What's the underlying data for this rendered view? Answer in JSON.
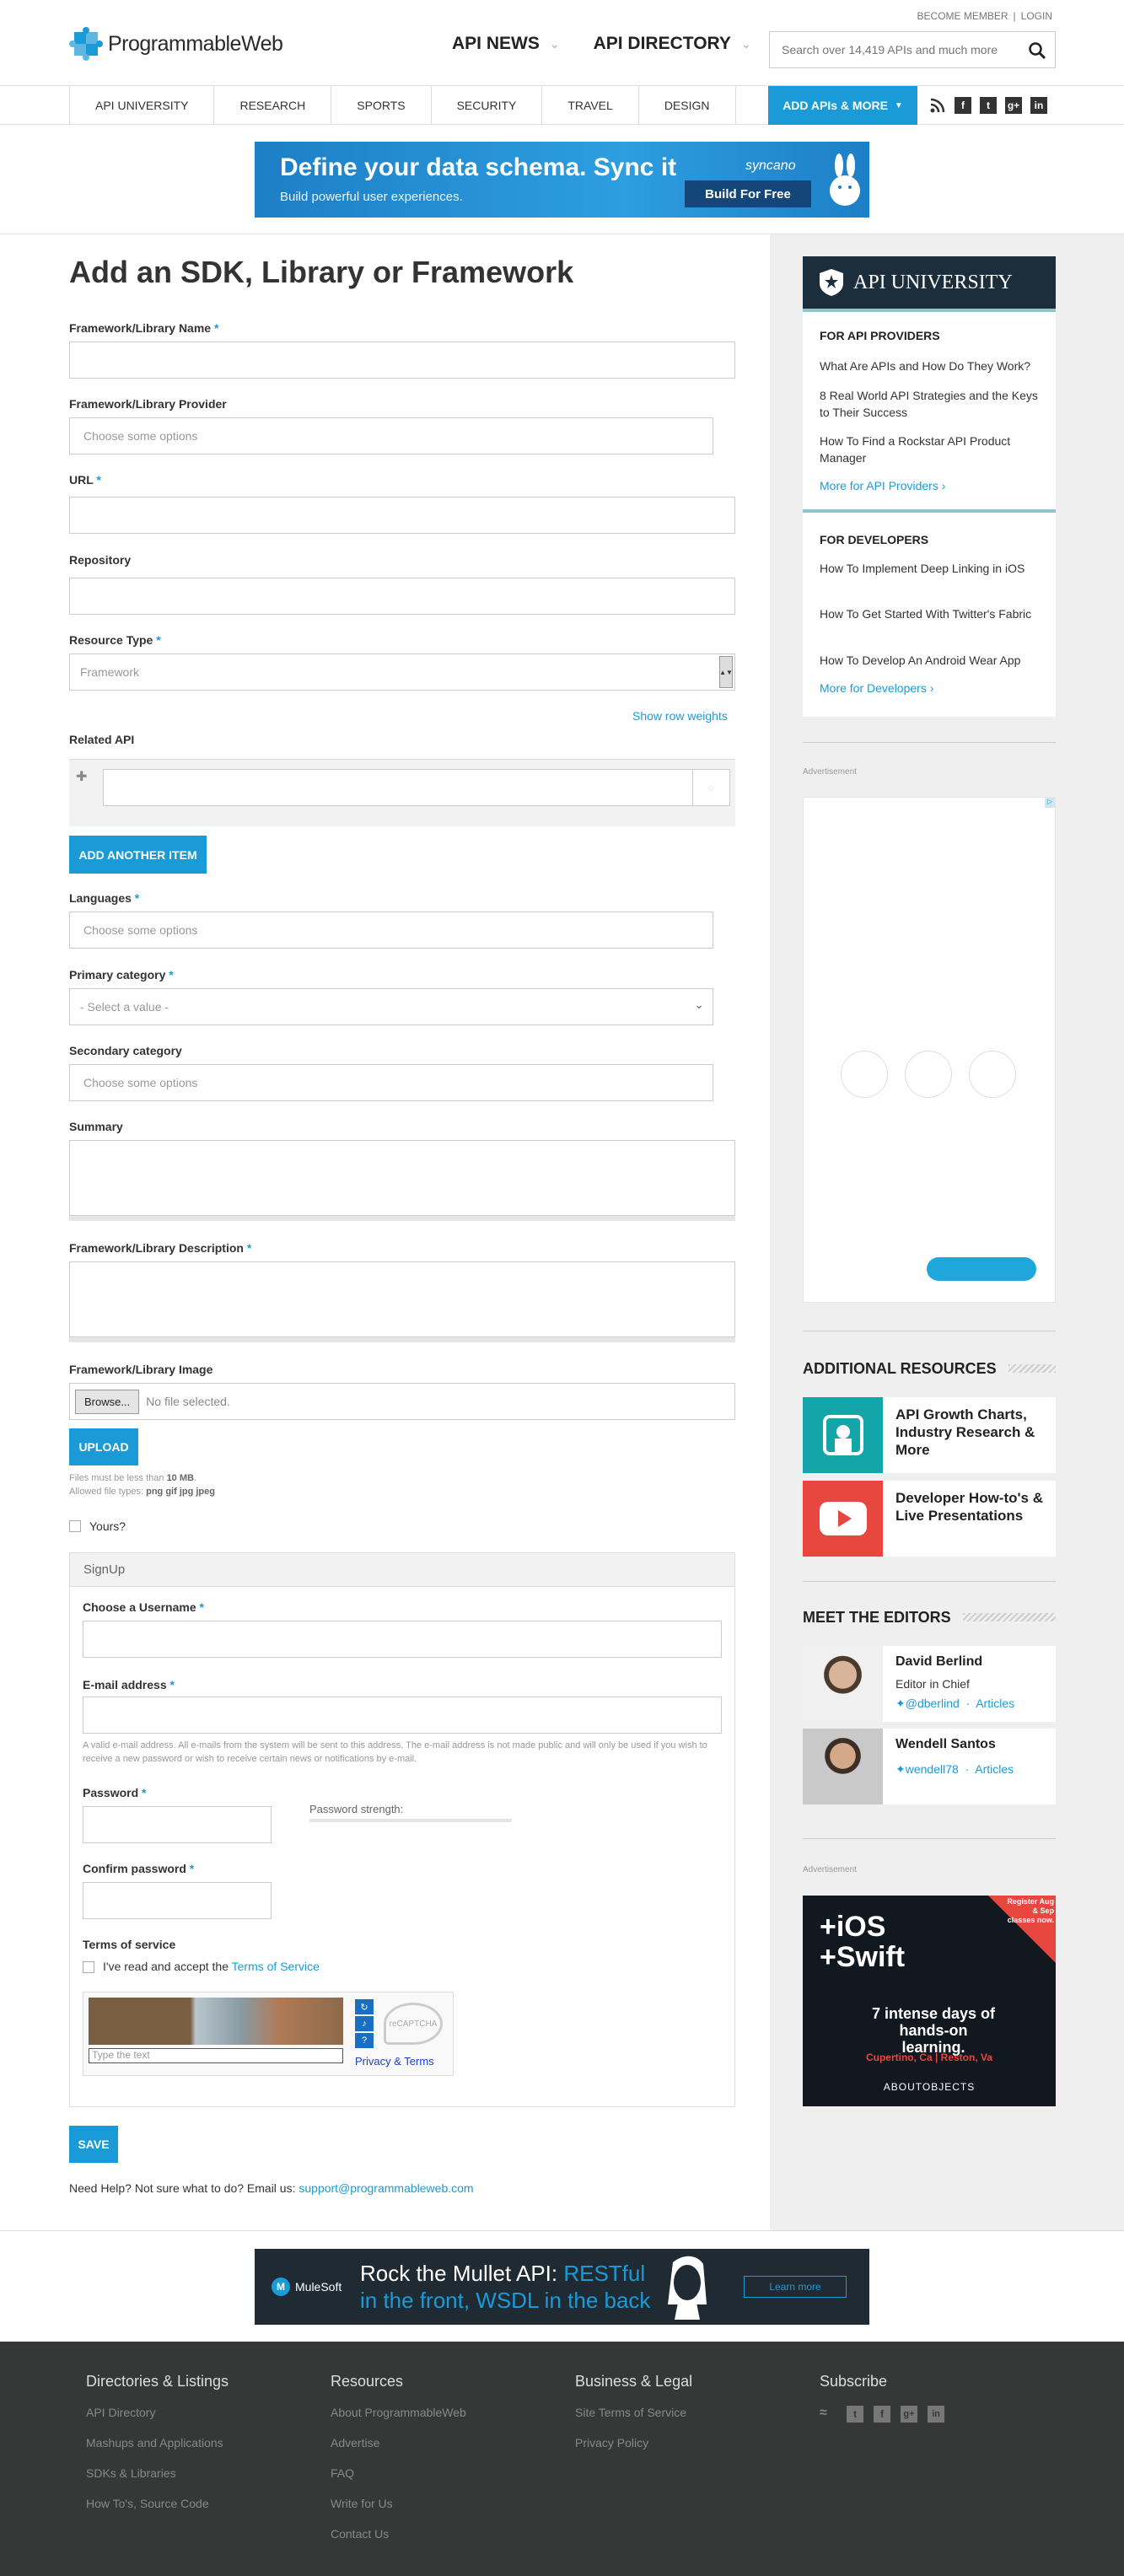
{
  "header": {
    "logo_text": "ProgrammableWeb",
    "become_member": "BECOME MEMBER",
    "login": "LOGIN",
    "nav": [
      "API NEWS",
      "API DIRECTORY"
    ],
    "search_placeholder": "Search over 14,419 APIs and much more"
  },
  "subnav": {
    "items": [
      "API UNIVERSITY",
      "RESEARCH",
      "SPORTS",
      "SECURITY",
      "TRAVEL",
      "DESIGN"
    ],
    "add_apis": "ADD APIs & MORE"
  },
  "top_banner": {
    "headline": "Define your data schema. Sync it",
    "sub": "Build powerful user experiences.",
    "brand": "syncano",
    "button": "Build For Free"
  },
  "form": {
    "title": "Add an SDK, Library or Framework",
    "name_label": "Framework/Library Name",
    "provider_label": "Framework/Library Provider",
    "provider_placeholder": "Choose some options",
    "url_label": "URL",
    "repo_label": "Repository",
    "resource_type_label": "Resource Type",
    "resource_type_value": "Framework",
    "show_row_weights": "Show row weights",
    "related_api_label": "Related API",
    "add_another": "ADD ANOTHER ITEM",
    "languages_label": "Languages",
    "languages_placeholder": "Choose some options",
    "primary_cat_label": "Primary category",
    "primary_cat_value": "- Select a value -",
    "secondary_cat_label": "Secondary category",
    "secondary_cat_placeholder": "Choose some options",
    "summary_label": "Summary",
    "description_label": "Framework/Library Description",
    "image_label": "Framework/Library Image",
    "browse": "Browse...",
    "no_file": "No file selected.",
    "upload": "UPLOAD",
    "file_note_prefix": "Files must be less than ",
    "file_note_size": "10 MB",
    "file_note_dot": ".",
    "file_types_prefix": "Allowed file types: ",
    "file_types": "png gif jpg jpeg",
    "yours": "Yours?",
    "signup_title": "SignUp",
    "username_label": "Choose a Username",
    "email_label": "E-mail address",
    "email_note": "A valid e-mail address. All e-mails from the system will be sent to this address. The e-mail address is not made public and will only be used if you wish to receive a new password or wish to receive certain news or notifications by e-mail.",
    "password_label": "Password",
    "password_strength": "Password strength:",
    "confirm_label": "Confirm password",
    "tos_label": "Terms of service",
    "tos_text": "I've read and accept the ",
    "tos_link": "Terms of Service",
    "captcha_placeholder": "Type the text",
    "captcha_privacy": "Privacy & Terms",
    "captcha_brand": "reCAPTCHA",
    "save": "SAVE",
    "help_text": "Need Help? Not sure what to do? Email us: ",
    "help_email": "support@programmableweb.com"
  },
  "sidebar": {
    "api_university": "API UNIVERSITY",
    "providers_title": "FOR API PROVIDERS",
    "providers": [
      "What Are APIs and How Do They Work?",
      "8 Real World API Strategies and the Keys to Their Success",
      "How To Find a Rockstar API Product Manager"
    ],
    "providers_more": "More for API Providers",
    "developers_title": "FOR DEVELOPERS",
    "developers": [
      "How To Implement Deep Linking in iOS",
      "How To Get Started With Twitter's Fabric",
      "How To Develop An Android Wear App"
    ],
    "developers_more": "More for Developers",
    "advertisement": "Advertisement",
    "additional_resources": "ADDITIONAL RESOURCES",
    "resources": [
      "API Growth Charts, Industry Research & More",
      "Developer How-to's & Live Presentations"
    ],
    "meet_editors": "MEET THE EDITORS",
    "editors": [
      {
        "name": "David Berlind",
        "role": "Editor in Chief",
        "twitter": "@dberlind",
        "articles": "Articles"
      },
      {
        "name": "Wendell Santos",
        "role": "",
        "twitter": "wendell78",
        "articles": "Articles"
      }
    ],
    "ad2": {
      "line1": "+iOS",
      "line2": "+Swift",
      "body": "7 intense days of hands-on learning.",
      "places": "Cupertino, Ca | Reston, Va",
      "brand": "ABOUTOBJECTS",
      "corner": "Register Aug & Sep classes now."
    }
  },
  "bottom_banner": {
    "brand": "MuleSoft",
    "line1_a": "Rock the Mullet API: ",
    "line1_b": "RESTful",
    "line2": "in the front, WSDL in the back",
    "button": "Learn more"
  },
  "footer": {
    "cols": [
      {
        "title": "Directories & Listings",
        "links": [
          "API Directory",
          "Mashups and Applications",
          "SDKs & Libraries",
          "How To's, Source Code"
        ]
      },
      {
        "title": "Resources",
        "links": [
          "About ProgrammableWeb",
          "Advertise",
          "FAQ",
          "Write for Us",
          "Contact Us"
        ]
      },
      {
        "title": "Business & Legal",
        "links": [
          "Site Terms of Service",
          "Privacy Policy"
        ]
      },
      {
        "title": "Subscribe",
        "links": []
      }
    ]
  },
  "colors": {
    "accent": "#1a9bd7",
    "navy": "#1c2e3c",
    "teal": "#13a5a8",
    "red": "#e8473f",
    "footer": "#363838"
  }
}
